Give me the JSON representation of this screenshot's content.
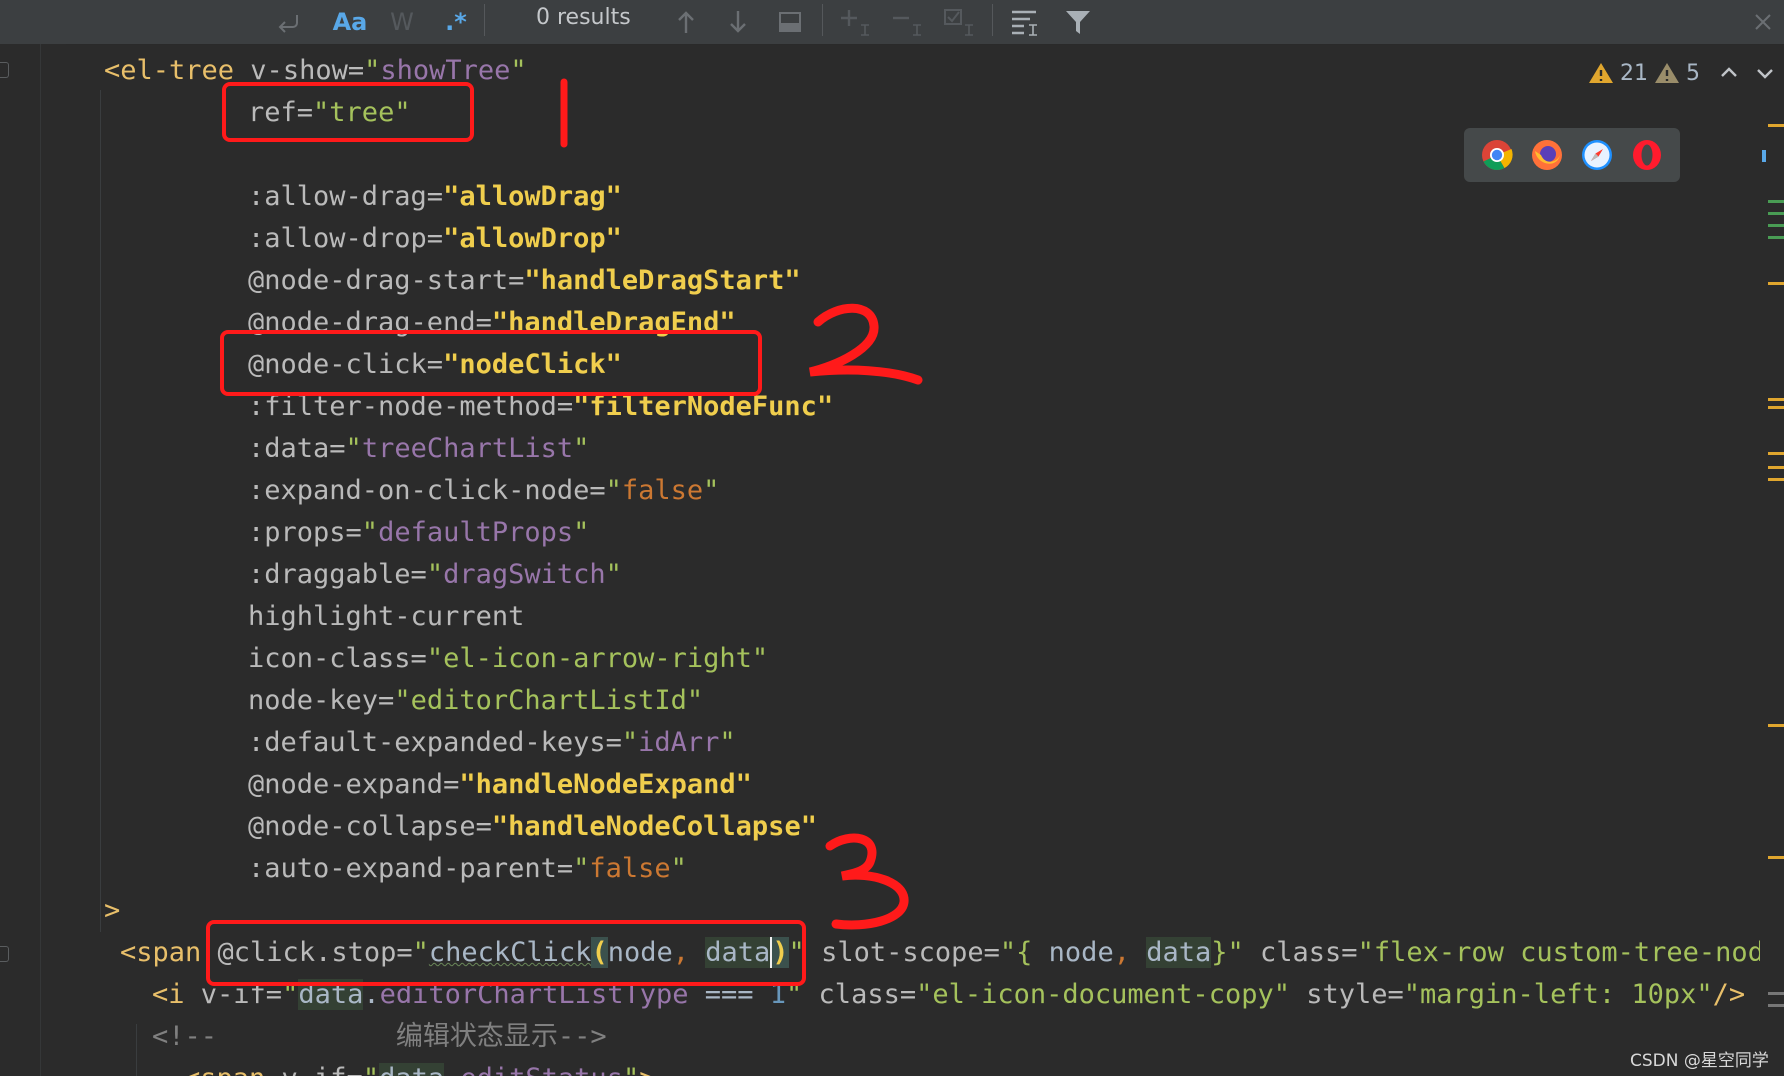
{
  "toolbar": {
    "match_case_label": "Aa",
    "words_label": "W",
    "regex_label": ".*",
    "results_text": "0 results"
  },
  "warnings": {
    "error_count": "21",
    "warning_count": "5"
  },
  "code": {
    "l1": {
      "tag": "<el-tree",
      "attr": " v-show=",
      "q1": "\"",
      "val": "showTree",
      "q2": "\""
    },
    "l2": {
      "attr": "ref=",
      "q1": "\"",
      "val": "tree",
      "q2": "\""
    },
    "l4": {
      "attr": ":allow-drag=",
      "val": "\"allowDrag\""
    },
    "l5": {
      "attr": ":allow-drop=",
      "val": "\"allowDrop\""
    },
    "l6": {
      "attr": "@node-drag-start=",
      "val": "\"handleDragStart\""
    },
    "l7": {
      "attr": "@node-drag-end=",
      "val": "\"handleDragEnd\""
    },
    "l8": {
      "attr": "@node-click=",
      "val": "\"nodeClick\""
    },
    "l9": {
      "attr": ":filter-node-method=",
      "val": "\"filterNodeFunc\""
    },
    "l10": {
      "attr": ":data=",
      "q1": "\"",
      "val": "treeChartList",
      "q2": "\""
    },
    "l11": {
      "attr": ":expand-on-click-node=",
      "q1": "\"",
      "val": "false",
      "q2": "\""
    },
    "l12": {
      "attr": ":props=",
      "q1": "\"",
      "val": "defaultProps",
      "q2": "\""
    },
    "l13": {
      "attr": ":draggable=",
      "q1": "\"",
      "val": "dragSwitch",
      "q2": "\""
    },
    "l14": {
      "attr": "highlight-current"
    },
    "l15": {
      "attr": "icon-class=",
      "val": "\"el-icon-arrow-right\""
    },
    "l16": {
      "attr": "node-key=",
      "val": "\"editorChartListId\""
    },
    "l17": {
      "attr": ":default-expanded-keys=",
      "q1": "\"",
      "val": "idArr",
      "q2": "\""
    },
    "l18": {
      "attr": "@node-expand=",
      "val": "\"handleNodeExpand\""
    },
    "l19": {
      "attr": "@node-collapse=",
      "val": "\"handleNodeCollapse\""
    },
    "l20": {
      "attr": ":auto-expand-parent=",
      "q1": "\"",
      "val": "false",
      "q2": "\""
    },
    "l21": {
      "tag": ">"
    },
    "l22": {
      "tag": "<span",
      "attr1": " @click.stop=",
      "q1": "\"",
      "fn": "checkClick",
      "paren_open": "(",
      "arg1": "node",
      "comma": ", ",
      "arg2": "data",
      "paren_close": ")",
      "q2": "\"",
      "attr2": " slot-scope=",
      "s1": "\"{ ",
      "n2": "node",
      "c2": ", ",
      "d2": "data",
      "s2": "}\"",
      "attr3": " class=",
      "cls": "\"flex-row custom-tree-node f"
    },
    "l23": {
      "tag": "<i",
      "attr1": " v-if=",
      "q1": "\"",
      "obj": "data",
      "dot": ".",
      "prop": "editorChartListType",
      "op": " === ",
      "num": "1",
      "q2": "\"",
      "attr2": " class=",
      "cls": "\"el-icon-document-copy\"",
      "attr3": " style=",
      "sty": "\"margin-left: 10px\"",
      "end": "/>"
    },
    "l24": {
      "cmt": "<!--           编辑状态显示-->"
    },
    "l25": {
      "tag": "<span",
      "attr": " v-if=",
      "q1": "\"",
      "obj": "data",
      "dot": ".",
      "prop": "editStatus",
      "q2": "\"",
      "end": ">"
    }
  },
  "watermark": "CSDN @星空同学",
  "colors": {
    "annotation_red": "#ff1a1a",
    "string_green": "#a5c25c",
    "tag_yellow": "#e8bf6a",
    "ident_purple": "#9876aa",
    "keyword_orange": "#cc7832"
  },
  "icons": [
    "match-case-icon",
    "whole-words-icon",
    "regex-icon",
    "up-arrow-icon",
    "down-arrow-icon",
    "filter-icon",
    "chrome-icon",
    "firefox-icon",
    "safari-icon",
    "opera-icon"
  ]
}
